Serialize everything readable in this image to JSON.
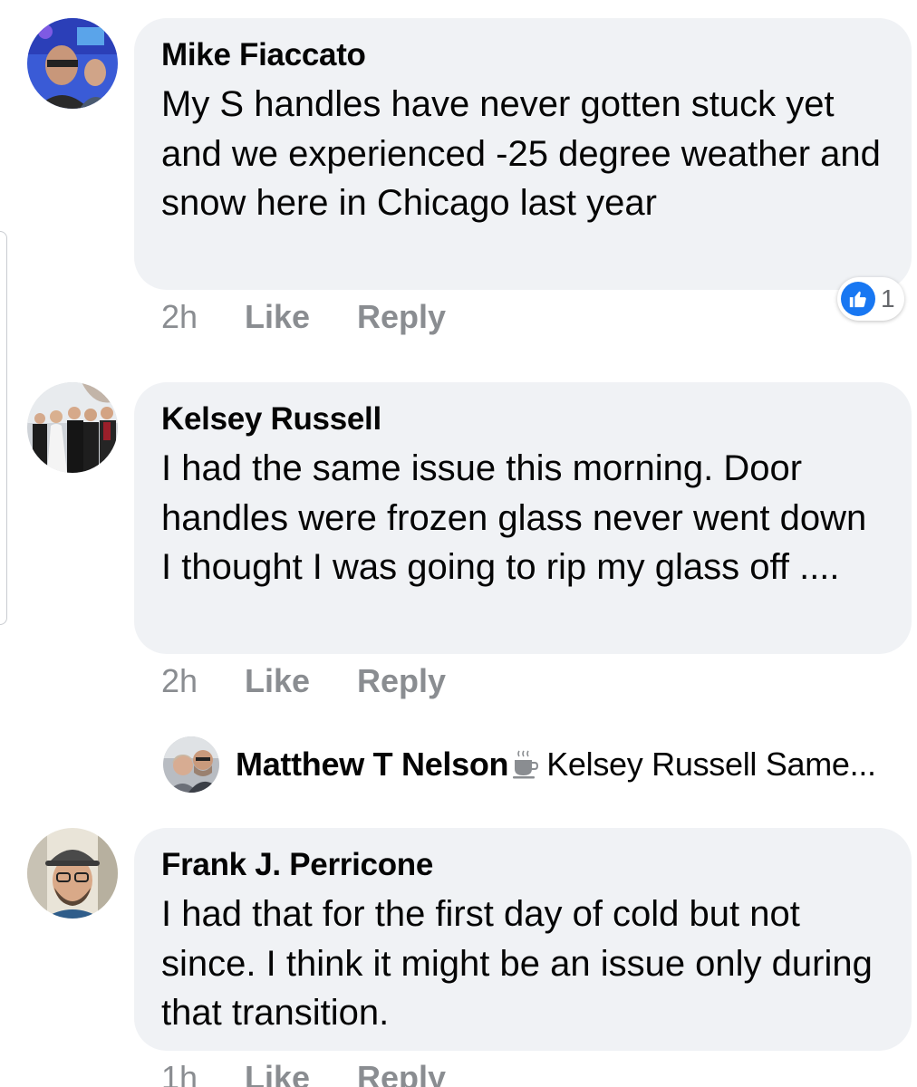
{
  "comments": [
    {
      "author": "Mike Fiaccato",
      "text": "My S handles have never gotten stuck yet and we experienced -25 degree weather and snow here in Chicago last year",
      "time": "2h",
      "like_label": "Like",
      "reply_label": "Reply",
      "reaction": {
        "icon": "like-icon",
        "count": "1",
        "color": "#1877f2"
      }
    },
    {
      "author": "Kelsey Russell",
      "text": "I had the same issue this morning. Door handles were frozen glass never went down I thought I was going to rip my glass off ....",
      "time": "2h",
      "like_label": "Like",
      "reply_label": "Reply"
    },
    {
      "author": "Frank J. Perricone",
      "text": "I had that for the first day of cold but not since. I think it might be an issue only during that transition.",
      "time": "1h",
      "like_label": "Like",
      "reply_label": "Reply"
    }
  ],
  "reply_preview": {
    "author": "Matthew T Nelson",
    "badge_icon": "coffee-cup-icon",
    "text": "Kelsey Russell Same..."
  },
  "colors": {
    "bubble": "#f0f2f5",
    "meta": "#8a8d91",
    "like_blue": "#1877f2"
  }
}
